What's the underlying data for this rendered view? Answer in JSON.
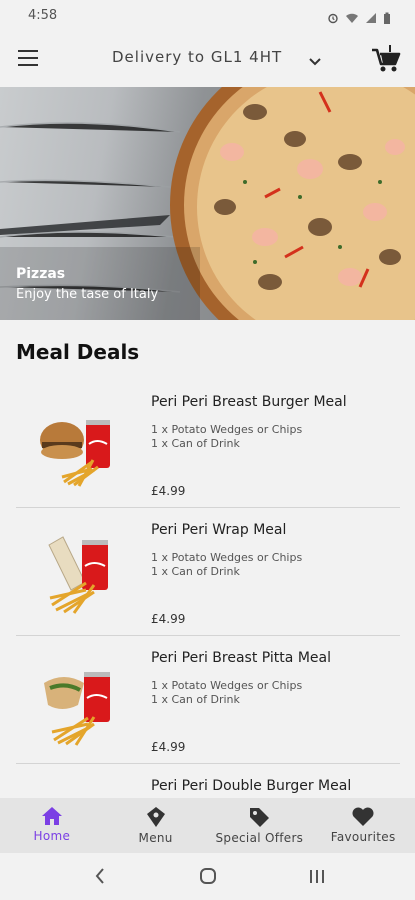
{
  "status_bar": {
    "time": "4:58"
  },
  "app_bar": {
    "delivery_label": "Delivery to GL1 4HT"
  },
  "hero": {
    "title": "Pizzas",
    "subtitle": "Enjoy the tase of Italy"
  },
  "section_title": "Meal Deals",
  "deals": [
    {
      "name": "Peri Peri Breast Burger Meal",
      "line1": "1 x Potato Wedges or Chips",
      "line2": "1 x Can of Drink",
      "price": "£4.99"
    },
    {
      "name": "Peri Peri Wrap Meal",
      "line1": "1 x Potato Wedges or Chips",
      "line2": "1 x Can of Drink",
      "price": "£4.99"
    },
    {
      "name": "Peri Peri Breast Pitta Meal",
      "line1": "1 x Potato Wedges or Chips",
      "line2": "1 x Can of Drink",
      "price": "£4.99"
    },
    {
      "name": "Peri Peri Double Burger Meal",
      "line1": "",
      "line2": "",
      "price": ""
    }
  ],
  "bottom_nav": [
    {
      "label": "Home",
      "icon": "home-icon",
      "active": true
    },
    {
      "label": "Menu",
      "icon": "menu-tag-icon",
      "active": false
    },
    {
      "label": "Special Offers",
      "icon": "tag-icon",
      "active": false
    },
    {
      "label": "Favourites",
      "icon": "heart-icon",
      "active": false
    }
  ],
  "colors": {
    "accent": "#7b3fe4",
    "background": "#f2f2f2",
    "nav_background": "#e4e4e4"
  }
}
